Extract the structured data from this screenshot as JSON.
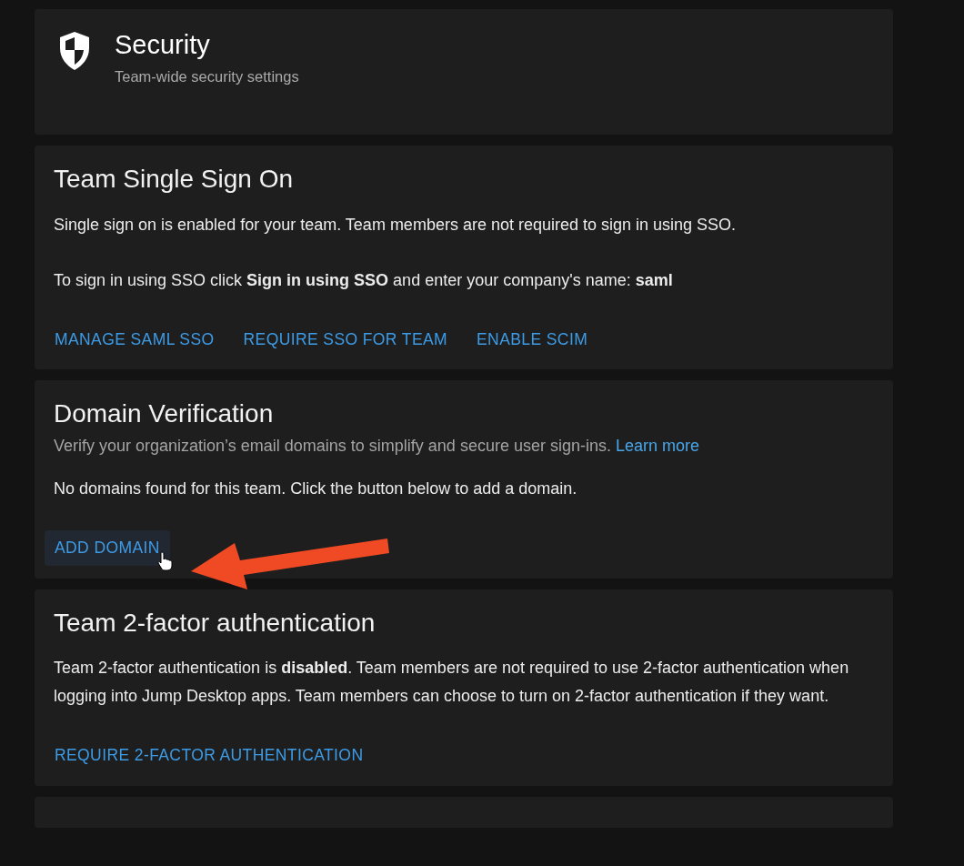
{
  "header": {
    "title": "Security",
    "subtitle": "Team-wide security settings"
  },
  "sections": [
    {
      "title": "Team Single Sign On",
      "paragraphs": [
        "Single sign on is enabled for your team. Team members are not required to sign in using SSO.",
        "To sign in using SSO click **Sign in using SSO** and enter your company's name: **saml**"
      ],
      "actions": [
        {
          "label": "MANAGE SAML SSO",
          "hovered": false
        },
        {
          "label": "REQUIRE SSO FOR TEAM",
          "hovered": false
        },
        {
          "label": "ENABLE SCIM",
          "hovered": false
        }
      ]
    },
    {
      "title": "Domain Verification",
      "subtitle": "Verify your organization’s email domains to simplify and secure user sign-ins.",
      "subtitle_link": "Learn more",
      "paragraphs": [
        "No domains found for this team. Click the button below to add a domain."
      ],
      "actions": [
        {
          "label": "ADD DOMAIN",
          "hovered": true
        }
      ]
    },
    {
      "title": "Team 2-factor authentication",
      "paragraphs": [
        "Team 2-factor authentication is **disabled**. Team members are not required to use 2-factor authentication when logging into Jump Desktop apps. Team members can choose to turn on 2-factor authentication if they want."
      ],
      "actions": [
        {
          "label": "REQUIRE 2-FACTOR AUTHENTICATION",
          "hovered": false
        }
      ]
    }
  ]
}
